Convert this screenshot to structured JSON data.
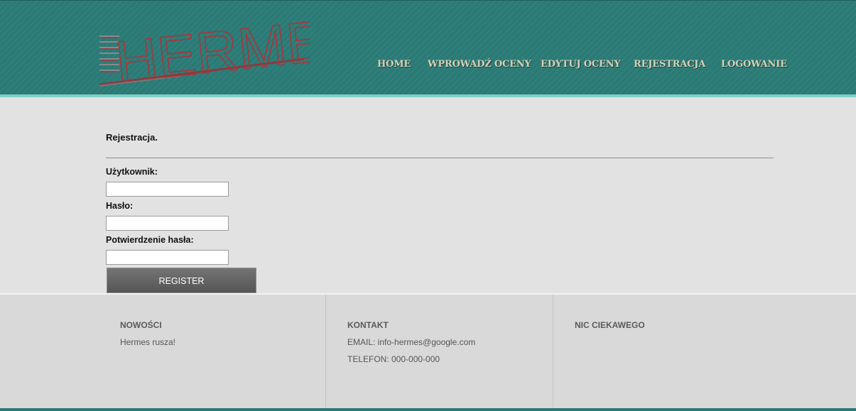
{
  "header": {
    "logo_text": "HERMES",
    "nav": [
      {
        "label": "HOME"
      },
      {
        "label": "WPROWADŹ OCENY"
      },
      {
        "label": "EDYTUJ OCENY"
      },
      {
        "label": "REJESTRACJA"
      },
      {
        "label": "LOGOWANIE"
      }
    ]
  },
  "form": {
    "title": "Rejestracja.",
    "username_label": "Użytkownik:",
    "password_label": "Hasło:",
    "confirm_label": "Potwierdzenie hasła:",
    "username_value": "",
    "password_value": "",
    "confirm_value": "",
    "submit_label": "REGISTER"
  },
  "footer": {
    "news_heading": "NOWOŚCI",
    "news_text": "Hermes rusza!",
    "contact_heading": "KONTAKT",
    "contact_email": "EMAIL: info-hermes@google.com",
    "contact_phone": "TELEFON: 000-000-000",
    "other_heading": "NIC CIEKAWEGO"
  },
  "colors": {
    "header_bg": "#2a7a76",
    "logo_red": "#a8363b",
    "nav_text": "#d6d0b6",
    "button_bg": "#666666"
  }
}
